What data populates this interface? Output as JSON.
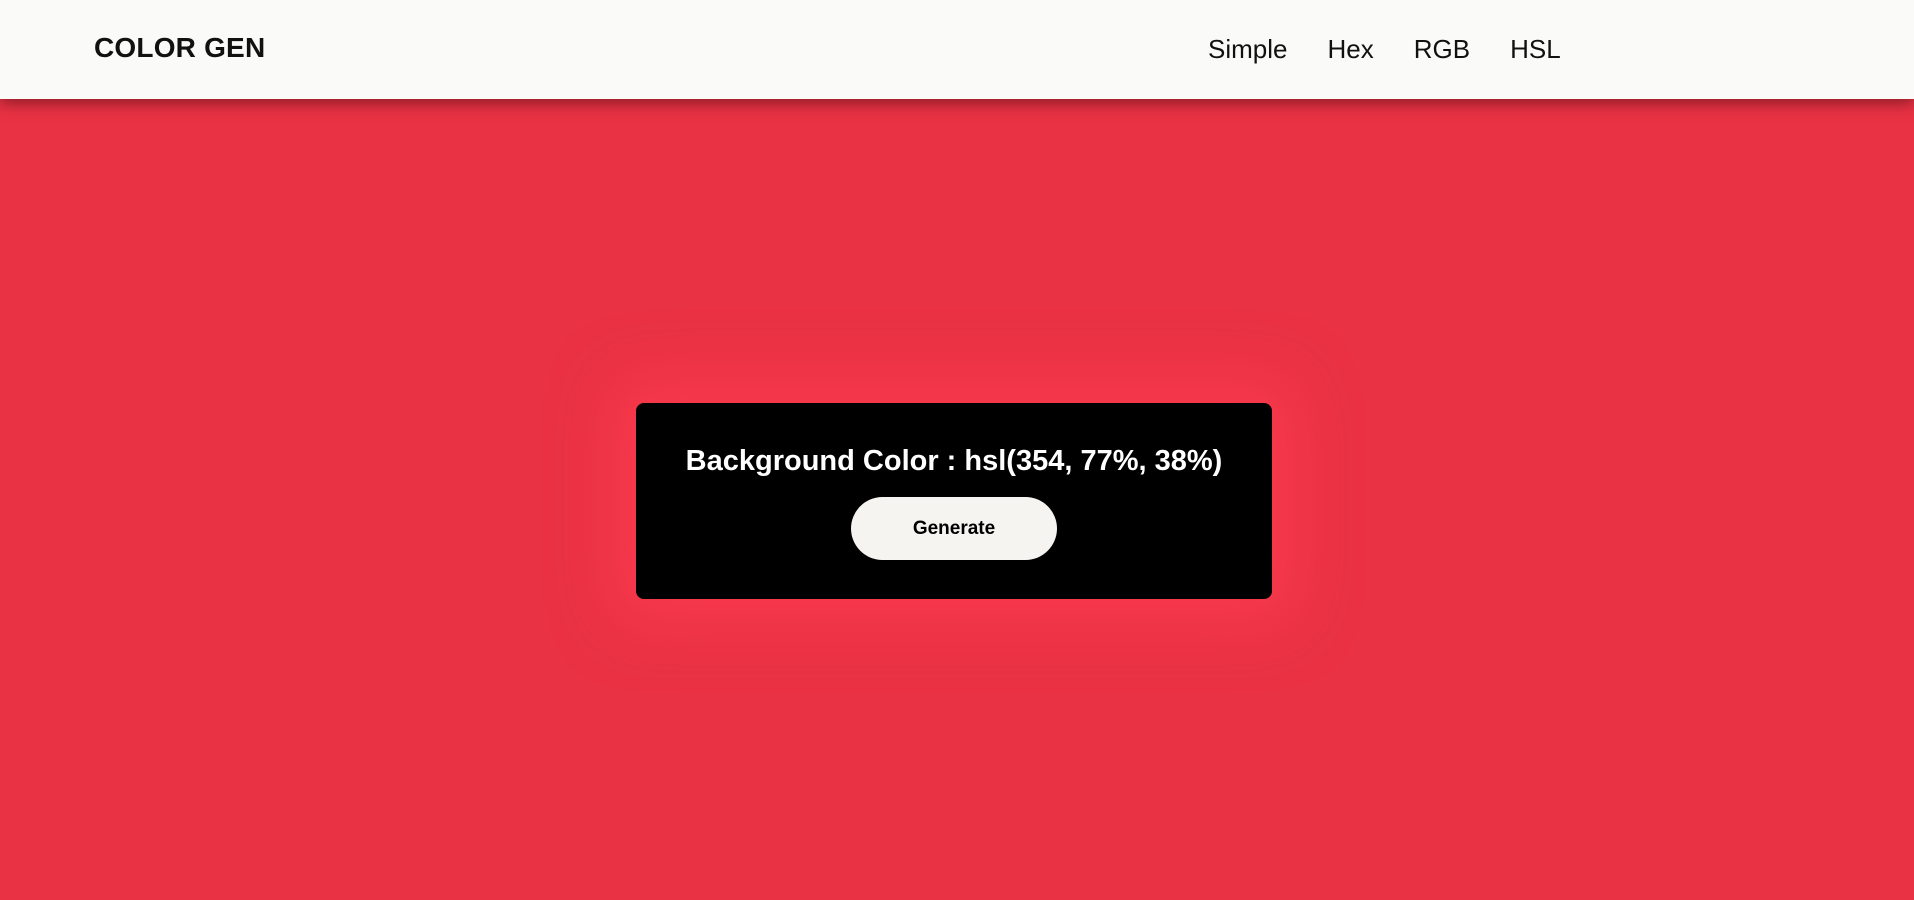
{
  "app": {
    "brand": "COLOR GEN"
  },
  "nav": {
    "items": [
      {
        "label": "Simple"
      },
      {
        "label": "Hex"
      },
      {
        "label": "RGB"
      },
      {
        "label": "HSL"
      }
    ]
  },
  "main": {
    "background_color": "#e93244",
    "card": {
      "label": "Background Color : ",
      "value": "hsl(354, 77%, 38%)",
      "button_label": "Generate"
    }
  },
  "colors": {
    "navbar_bg": "#fafaf8",
    "card_bg": "#000000",
    "button_bg": "#f6f4f0",
    "text_dark": "#111111",
    "text_light": "#ffffff"
  }
}
